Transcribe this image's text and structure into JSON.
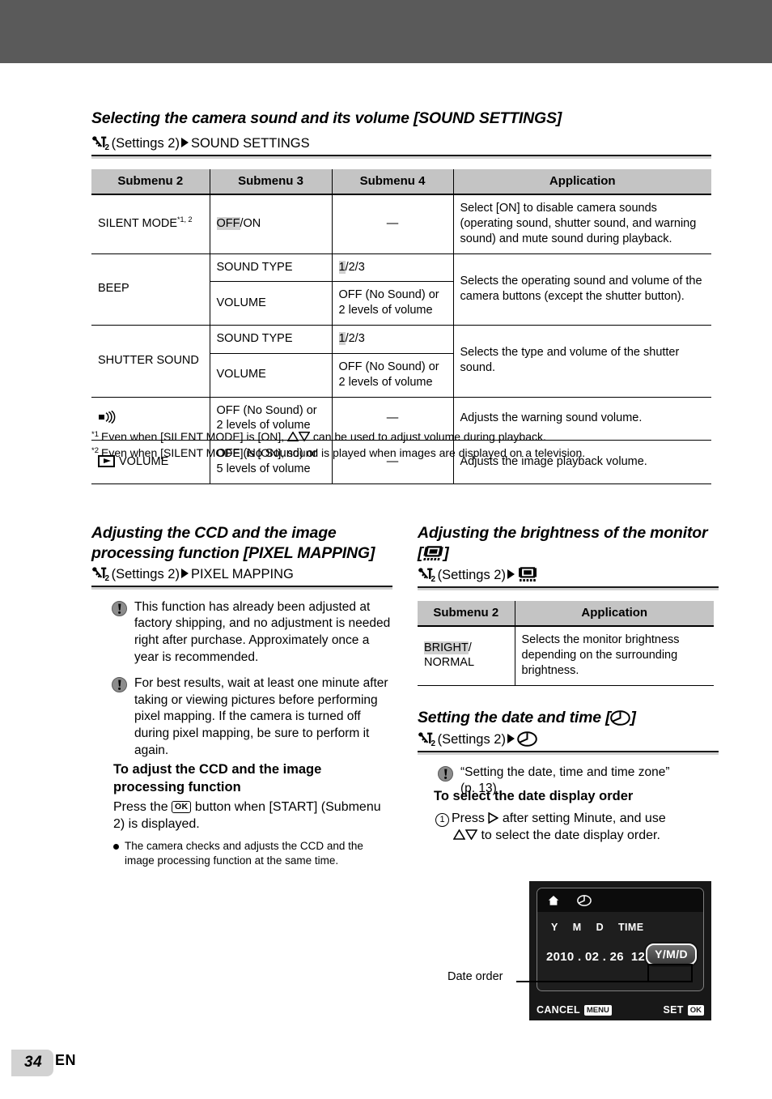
{
  "page": {
    "number": "34",
    "language_code": "EN"
  },
  "section1": {
    "title": "Selecting the camera sound and its volume [SOUND SETTINGS]",
    "path_prefix": "(Settings 2)",
    "path_target": "SOUND SETTINGS",
    "settings_subscript": "2",
    "table": {
      "headers": [
        "Submenu 2",
        "Submenu 3",
        "Submenu 4",
        "Application"
      ],
      "rows": [
        {
          "submenu2": "SILENT MODE",
          "submenu2_sup": "*1, 2",
          "submenu3_hl": "OFF",
          "submenu3_rest": "/ON",
          "submenu4": "—",
          "application": "Select [ON] to disable camera sounds (operating sound, shutter sound, and warning sound) and mute sound during playback."
        },
        {
          "submenu2": "BEEP",
          "application": "Selects the operating sound and volume of the camera buttons (except the shutter button).",
          "sub_rows": [
            {
              "submenu3": "SOUND TYPE",
              "submenu4_hl": "1",
              "submenu4_rest": "/2/3"
            },
            {
              "submenu3": "VOLUME",
              "submenu4": "OFF (No Sound) or 2 levels of volume"
            }
          ]
        },
        {
          "submenu2": "SHUTTER SOUND",
          "application": "Selects the type and volume of the shutter sound.",
          "sub_rows": [
            {
              "submenu3": "SOUND TYPE",
              "submenu4_hl": "1",
              "submenu4_rest": "/2/3"
            },
            {
              "submenu3": "VOLUME",
              "submenu4": "OFF (No Sound) or 2 levels of volume"
            }
          ]
        },
        {
          "submenu2_icon": "speaker-warning-icon",
          "submenu2": "",
          "submenu3": "OFF (No Sound) or 2 levels of volume",
          "submenu4": "—",
          "application": "Adjusts the warning sound volume."
        },
        {
          "submenu2_icon": "playback-icon",
          "submenu2": "VOLUME",
          "submenu3": "OFF (No Sound) or 5 levels of volume",
          "submenu4": "—",
          "application": "Adjusts the image playback volume."
        }
      ]
    },
    "footnotes": [
      {
        "mark": "*1",
        "text_before": "Even when [SILENT MODE] is [ON],",
        "text_after": "can be used to adjust volume during playback."
      },
      {
        "mark": "*2",
        "text_before": "Even when [SILENT MODE] is [ON], sound is played when images are displayed on a television.",
        "text_after": ""
      }
    ]
  },
  "section2": {
    "title_line1": "Adjusting the CCD and the image",
    "title_line2": "processing function [PIXEL MAPPING]",
    "path_prefix": "(Settings 2)",
    "path_target": "PIXEL MAPPING",
    "notes": [
      "This function has already been adjusted at factory shipping, and no adjustment is needed right after purchase. Approximately once a year is recommended.",
      "For best results, wait at least one minute after taking or viewing pictures before performing pixel mapping. If the camera is turned off during pixel mapping, be sure to perform it again."
    ],
    "sub_heading_line1": "To adjust the CCD and the image",
    "sub_heading_line2": "processing function",
    "instruction_before": "Press the",
    "ok_button": "OK",
    "instruction_after": "button when [START] (Submenu 2) is displayed.",
    "bullet": "The camera checks and adjusts the CCD and the image processing function at the same time."
  },
  "section3": {
    "title_line1": "Adjusting the brightness of the monitor",
    "title_line2_prefix": "[",
    "title_line2_suffix": "]",
    "monitor_icon": "monitor-brightness-icon",
    "path_prefix": "(Settings 2)",
    "table": {
      "headers": [
        "Submenu 2",
        "Application"
      ],
      "rows": [
        {
          "submenu2_hl": "BRIGHT",
          "submenu2_rest": "/",
          "submenu2_line2": "NORMAL",
          "application": "Selects the monitor brightness depending on the surrounding brightness."
        }
      ]
    }
  },
  "section4": {
    "title_prefix": "Setting the date and time [",
    "title_suffix": "]",
    "clock_icon": "clock-icon",
    "path_prefix": "(Settings 2)",
    "note_line1": "“Setting the date, time and time zone”",
    "note_line2": "(p. 13)",
    "sub_heading": "To select the date display order",
    "step_number": "1",
    "step_text_before": "Press",
    "step_text_mid": "after setting Minute, and use",
    "step_text_after": "to select the date display order."
  },
  "lcd": {
    "home_icon": "home-icon",
    "clock_icon": "clock-icon",
    "column_labels": [
      "Y",
      "M",
      "D",
      "TIME"
    ],
    "date_value": "2010 . 02 . 26",
    "time_value": "12 : 30",
    "date_order_value": "Y/M/D",
    "cancel_label": "CANCEL",
    "cancel_button": "MENU",
    "set_label": "SET",
    "set_button": "OK",
    "callout": "Date order"
  },
  "colors": {
    "top_band": "#5a5a5a",
    "table_header": "#c4c4c4",
    "highlight": "#d0d0d0",
    "lcd_background": "#181818"
  }
}
